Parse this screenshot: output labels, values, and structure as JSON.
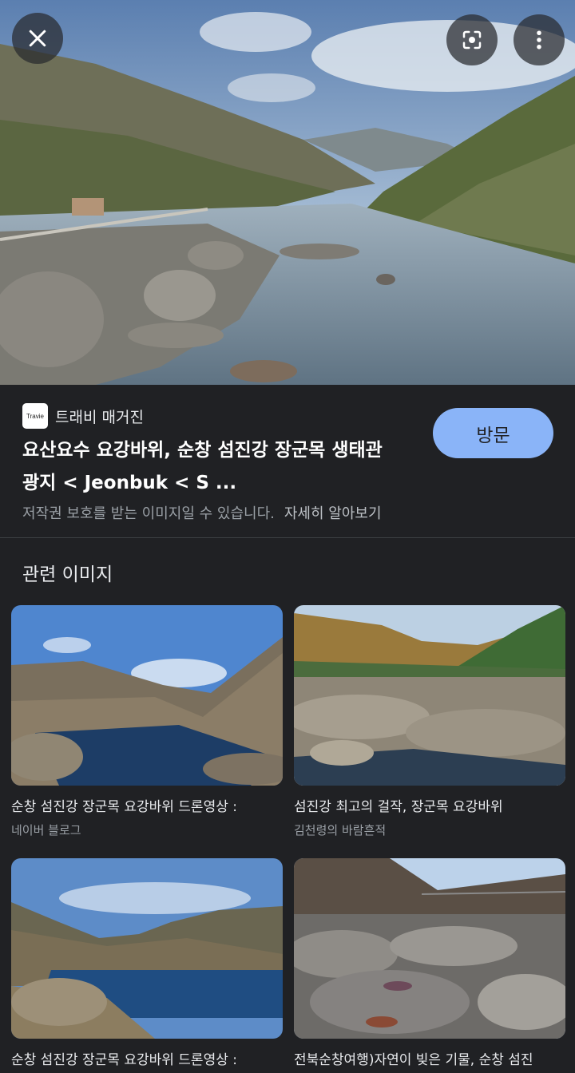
{
  "top_buttons": {
    "close_icon": "close-icon",
    "lens_icon": "lens-search-icon",
    "more_icon": "more-vert-icon"
  },
  "source": {
    "favicon_text": "Travie",
    "name": "트래비 매거진"
  },
  "result": {
    "title_line1": "요산요수 요강바위, 순창 섬진강 장군목 생태관",
    "title_line2": "광지 < Jeonbuk < S ..."
  },
  "visit_label": "방문",
  "copyright": {
    "notice": "저작권 보호를 받는 이미지일 수 있습니다.",
    "learn_more": "자세히 알아보기"
  },
  "related": {
    "heading": "관련 이미지",
    "items": [
      {
        "caption": "순창 섬진강 장군목 요강바위 드론영상 :",
        "source": "네이버 블로그"
      },
      {
        "caption": "섬진강 최고의 걸작, 장군목 요강바위",
        "source": "김천령의 바람흔적"
      },
      {
        "caption": "순창 섬진강 장군목 요강바위 드론영상 :",
        "source": ""
      },
      {
        "caption": "전북순창여행)자연이 빚은 기물, 순창 섬진",
        "source": ""
      }
    ]
  },
  "colors": {
    "background": "#202124",
    "visit_button": "#8ab4f8",
    "muted_text": "#9aa0a6"
  }
}
